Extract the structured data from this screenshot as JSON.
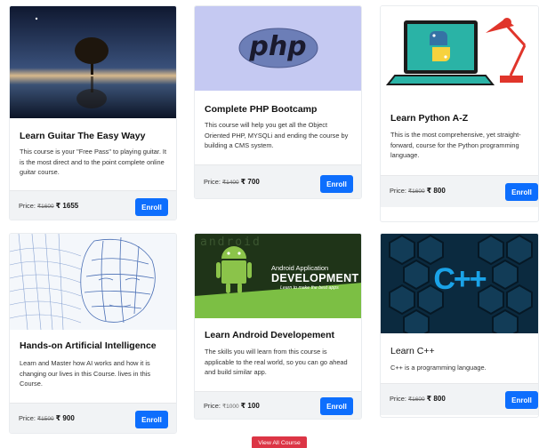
{
  "courses": [
    {
      "title": "Learn Guitar The Easy Wayy",
      "description": "This course is your \"Free Pass\" to playing guitar. It is the most direct and to the point complete online guitar course.",
      "price_label": "Price:",
      "old_price": "₹1600",
      "price": "₹ 1655",
      "button": "Enroll"
    },
    {
      "title": "Complete PHP Bootcamp",
      "description": "This course will help you get all the Object Oriented PHP, MYSQLi and ending the course by building a CMS system.",
      "price_label": "Price:",
      "old_price": "₹1400",
      "price": "₹ 700",
      "button": "Enroll",
      "logo_text": "php"
    },
    {
      "title": "Learn Python A-Z",
      "description": "This is the most comprehensive, yet straight-forward, course for the Python programming language.",
      "price_label": "Price:",
      "old_price": "₹1600",
      "price": "₹ 800",
      "button": "Enroll"
    },
    {
      "title": "Hands-on Artificial Intelligence",
      "description": "Learn and Master how AI works and how it is changing our lives in this Course. lives in this Course.",
      "price_label": "Price:",
      "old_price": "₹1500",
      "price": "₹ 900",
      "button": "Enroll"
    },
    {
      "title": "Learn Android Developement",
      "description": "The skills you will learn from this course is applicable to the real world, so you can go ahead and build similar app.",
      "price_label": "Price:",
      "old_price": "₹1000",
      "price": "₹ 100",
      "button": "Enroll",
      "banner_line1": "Android Application",
      "banner_line2": "DEVELOPMENT",
      "banner_line3": "Learn to make the best apps",
      "banner_bg_text": "android"
    },
    {
      "title": "Learn C++",
      "description": "C++ is a programming language.",
      "price_label": "Price:",
      "old_price": "₹1600",
      "price": "₹ 800",
      "button": "Enroll",
      "logo_text": "C++"
    }
  ],
  "view_all_label": "View All Course",
  "colors": {
    "primary": "#0d6efd",
    "danger": "#dc3545",
    "footer_bg": "#f1f3f5",
    "php_bg": "#c5c9f2",
    "php_logo": "#6c7eb7",
    "android_green": "#8bc34a",
    "cpp_bg": "#0b2a3f"
  },
  "icons": {
    "guitar_image": "tree-lake-night-image",
    "python_image": "laptop-python-lamp-image",
    "ai_image": "wireframe-face-image",
    "android_image": "android-robot-image",
    "cpp_image": "hexagon-cpp-image"
  }
}
